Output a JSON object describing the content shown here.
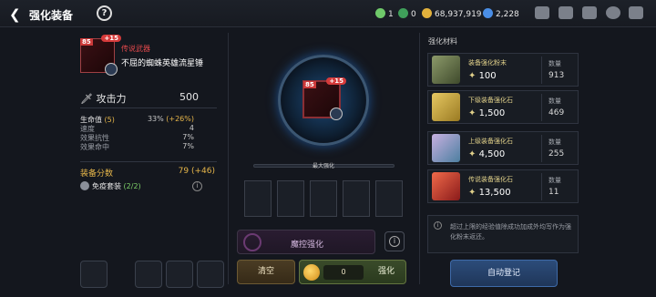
{
  "header": {
    "back_glyph": "❮",
    "title": "强化装备",
    "help_glyph": "?",
    "resources": [
      {
        "icon": "green-gem-icon",
        "value": "1",
        "color": "#6fc96a"
      },
      {
        "icon": "green-leaf-icon",
        "value": "0",
        "color": "#3f9f5a"
      },
      {
        "icon": "gold-coin-icon",
        "value": "68,937,919",
        "color": "#e2b13c"
      },
      {
        "icon": "blue-crystal-icon",
        "value": "2,228",
        "color": "#4a8ee6"
      }
    ]
  },
  "item": {
    "level": "85",
    "plus": "+15",
    "rarity": "传说武器",
    "name": "不屈的蜘蛛英雄流星锤",
    "attack_label": "攻击力",
    "attack_value": "500",
    "stats": [
      {
        "label": "生命值",
        "extra": "(5)",
        "value": "33%",
        "bonus": "(+26%)"
      },
      {
        "label": "速度",
        "value": "4"
      },
      {
        "label": "效果抗性",
        "value": "7%"
      },
      {
        "label": "效果命中",
        "value": "7%"
      }
    ],
    "score_label": "装备分数",
    "score_value": "79",
    "score_bonus": "(+46)",
    "set_name": "免疫套装",
    "set_progress": "(2/2)"
  },
  "center": {
    "max_label": "最大强化",
    "max_progress": 0,
    "magic_label": "魔控强化",
    "clear_label": "清空",
    "enhance_cost": "0",
    "enhance_label": "强化"
  },
  "materials": {
    "title": "强化材料",
    "qty_label": "数量",
    "items": [
      {
        "name": "装备强化粉末",
        "cost": "100",
        "qty": "913",
        "color": "#6a7a52"
      },
      {
        "name": "下级装备强化石",
        "cost": "1,500",
        "qty": "469",
        "color": "#c8a242"
      },
      {
        "name": "上级装备强化石",
        "cost": "4,500",
        "qty": "255",
        "color": "#6a8fa8"
      },
      {
        "name": "传说装备强化石",
        "cost": "13,500",
        "qty": "11",
        "color": "#b8362f"
      }
    ],
    "note": "超过上限的经验值除成功加成外均写作为强化粉末返还。",
    "auto_label": "自动登记"
  }
}
